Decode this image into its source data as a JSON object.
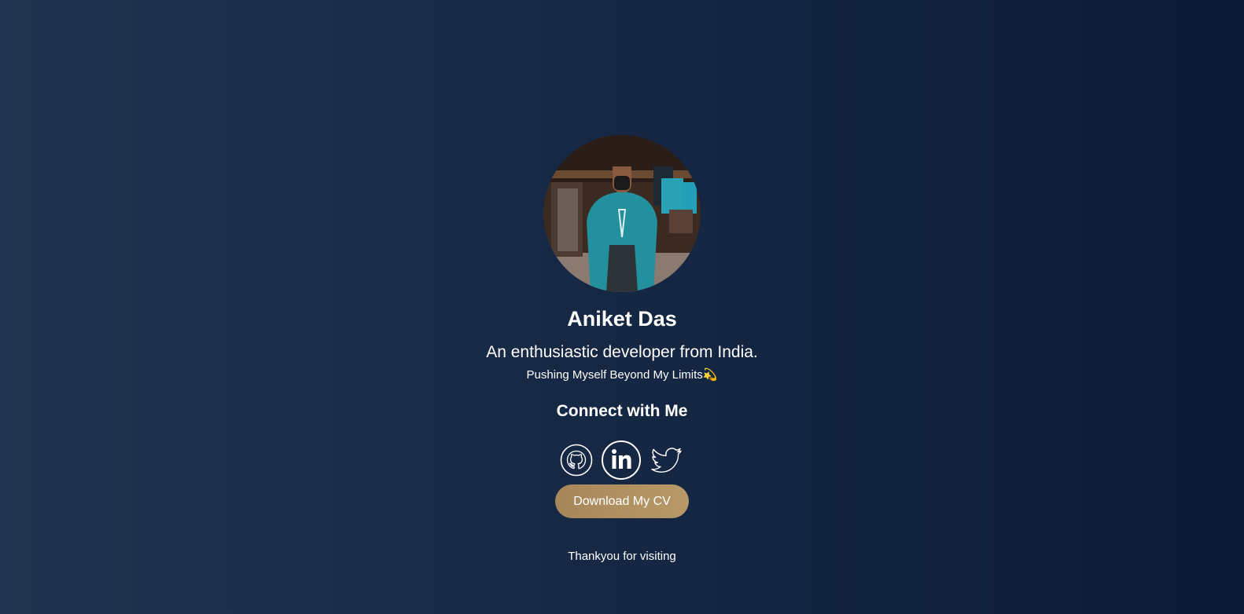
{
  "profile": {
    "name": "Aniket Das",
    "tagline": "An enthusiastic developer from India.",
    "motto": "Pushing Myself Beyond My Limits💫",
    "avatar_icon": "profile-photo"
  },
  "connect": {
    "heading": "Connect with Me",
    "links": [
      {
        "icon": "github-icon",
        "label": "GitHub"
      },
      {
        "icon": "linkedin-icon",
        "label": "LinkedIn"
      },
      {
        "icon": "twitter-icon",
        "label": "Twitter"
      }
    ]
  },
  "cv_button": {
    "label": "Download My CV"
  },
  "footer": {
    "text": "Thankyou for visiting"
  },
  "colors": {
    "background_start": "#21344f",
    "background_end": "#0b1a33",
    "button_gold": "#ad8e5f",
    "text": "#ffffff"
  }
}
